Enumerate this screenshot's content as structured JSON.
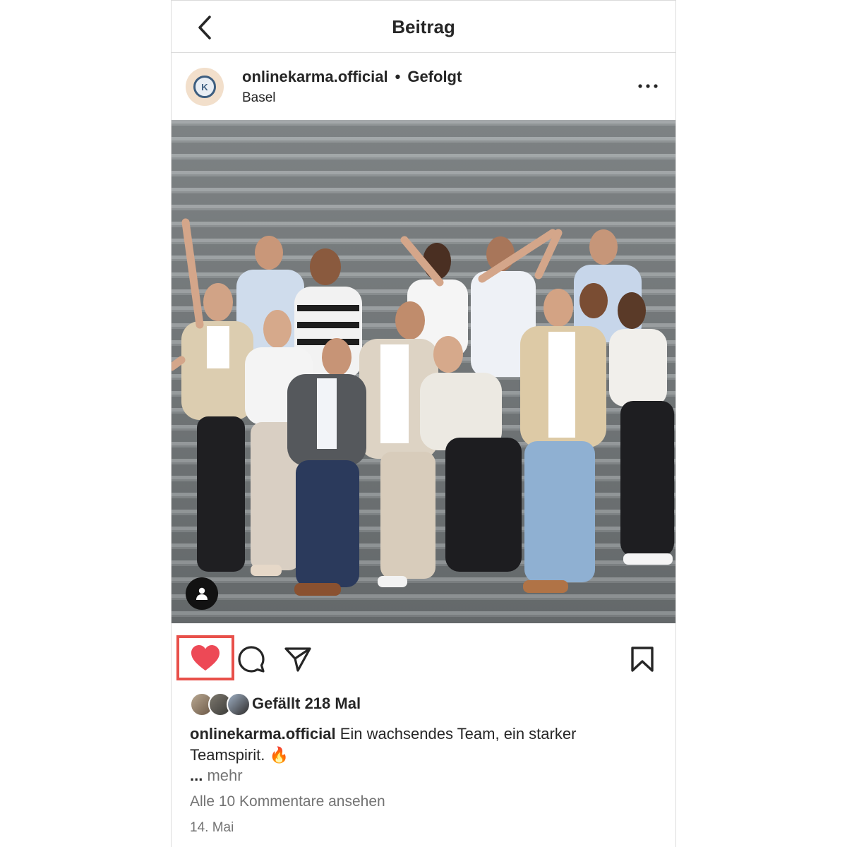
{
  "header": {
    "back_icon": "chevron-left-icon",
    "title": "Beitrag"
  },
  "post": {
    "username": "onlinekarma.official",
    "separator": "•",
    "follow_state": "Gefolgt",
    "location": "Basel",
    "more_icon": "more-horizontal-icon",
    "avatar_letter": "K"
  },
  "photo": {
    "tag_icon": "user-tag-icon"
  },
  "actions": {
    "like_icon": "heart-filled-icon",
    "like_color": "#ed4956",
    "highlight_color": "#e8504a",
    "comment_icon": "comment-icon",
    "share_icon": "send-icon",
    "save_icon": "bookmark-icon"
  },
  "likes": {
    "text": "Gefällt 218 Mal"
  },
  "caption": {
    "username": "onlinekarma.official",
    "text": "Ein wachsendes Team, ein starker Teamspirit. 🔥",
    "ellipsis": "...",
    "more": "mehr"
  },
  "comments": {
    "link": "Alle 10 Kommentare ansehen"
  },
  "date": "14. Mai"
}
